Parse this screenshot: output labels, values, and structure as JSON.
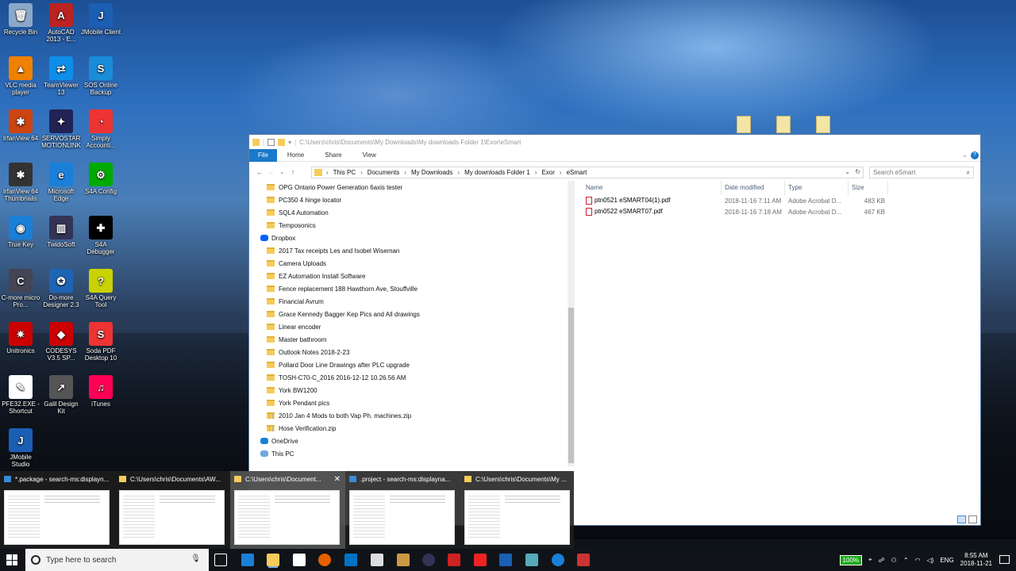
{
  "desktop_icons": [
    {
      "label": "Recycle Bin",
      "color": "#8ca8c8",
      "glyph": "🗑"
    },
    {
      "label": "AutoCAD 2013 - E...",
      "color": "#b22",
      "glyph": "A"
    },
    {
      "label": "JMobile Client",
      "color": "#1a5fb4",
      "glyph": "J"
    },
    {
      "label": "VLC media player",
      "color": "#f08000",
      "glyph": "▲"
    },
    {
      "label": "TeamViewer 13",
      "color": "#0e8ee9",
      "glyph": "⇄"
    },
    {
      "label": "SOS Online Backup",
      "color": "#1a8cd8",
      "glyph": "S"
    },
    {
      "label": "IrfanView 64",
      "color": "#c41",
      "glyph": "✱"
    },
    {
      "label": "SERVOSTAR MOTIONLINK",
      "color": "#225",
      "glyph": "✦"
    },
    {
      "label": "Simply Accounti...",
      "color": "#e33",
      "glyph": "◔"
    },
    {
      "label": "IrfanView 64 Thumbnails",
      "color": "#333",
      "glyph": "✱"
    },
    {
      "label": "Microsoft Edge",
      "color": "#1a7fd8",
      "glyph": "e"
    },
    {
      "label": "S4A Config",
      "color": "#0a0",
      "glyph": "⚙"
    },
    {
      "label": "True Key",
      "color": "#1a7fd8",
      "glyph": "◉"
    },
    {
      "label": "TwidoSoft",
      "color": "#335",
      "glyph": "▥"
    },
    {
      "label": "S4A Debugger",
      "color": "#000",
      "glyph": "✚"
    },
    {
      "label": "C-more micro Pro...",
      "color": "#445",
      "glyph": "C"
    },
    {
      "label": "Do-more Designer 2.3",
      "color": "#1e64b4",
      "glyph": "✪"
    },
    {
      "label": "S4A Query Tool",
      "color": "#c8d200",
      "glyph": "?"
    },
    {
      "label": "Unitronics",
      "color": "#c00",
      "glyph": "✷"
    },
    {
      "label": "CODESYS V3.5 SP...",
      "color": "#c00",
      "glyph": "◆"
    },
    {
      "label": "Soda PDF Desktop 10",
      "color": "#e33",
      "glyph": "S"
    },
    {
      "label": "PFE32.EXE - Shortcut",
      "color": "#fff",
      "glyph": "✎"
    },
    {
      "label": "Galil Design Kit",
      "color": "#555",
      "glyph": "↗"
    },
    {
      "label": "iTunes",
      "color": "#f05",
      "glyph": "♫"
    },
    {
      "label": "JMobile Studio",
      "color": "#1a5fb4",
      "glyph": "J"
    }
  ],
  "explorer": {
    "title_path": "C:\\Users\\chris\\Documents\\My Downloads\\My downloads Folder 1\\Exor\\eSmart",
    "ribbon_tabs": [
      "File",
      "Home",
      "Share",
      "View"
    ],
    "breadcrumb": [
      "This PC",
      "Documents",
      "My Downloads",
      "My downloads Folder 1",
      "Exor",
      "eSmart"
    ],
    "search_placeholder": "Search eSmart",
    "tree": [
      {
        "label": "OPG Ontario Power Generation 6axis tester",
        "kind": "folder"
      },
      {
        "label": "PC350 4 hinge locator",
        "kind": "folder"
      },
      {
        "label": "SQL4 Automation",
        "kind": "folder"
      },
      {
        "label": "Temposonics",
        "kind": "folder"
      },
      {
        "label": "Dropbox",
        "kind": "root"
      },
      {
        "label": "2017 Tax receipts Les and Isobel Wiseman",
        "kind": "folder"
      },
      {
        "label": "Camera Uploads",
        "kind": "folder"
      },
      {
        "label": "EZ Automation Install Software",
        "kind": "folder"
      },
      {
        "label": "Fence replacement 188 Hawthorn Ave, Stouffville",
        "kind": "folder"
      },
      {
        "label": "Financial Avrum",
        "kind": "folder"
      },
      {
        "label": "Grace Kennedy Bagger Kep Pics and All drawings",
        "kind": "folder"
      },
      {
        "label": "Linear encoder",
        "kind": "folder"
      },
      {
        "label": "Master bathroom",
        "kind": "folder"
      },
      {
        "label": "Outlook Notes 2018-2-23",
        "kind": "folder"
      },
      {
        "label": "Pollard Door Line Drawings after PLC upgrade",
        "kind": "folder"
      },
      {
        "label": "TOSH-C70-C_2016 2016-12-12 10.26.56 AM",
        "kind": "folder"
      },
      {
        "label": "York BW1200",
        "kind": "folder"
      },
      {
        "label": "York Pendant pics",
        "kind": "folder"
      },
      {
        "label": "2010 Jan 4  Mods to both Vap Ph. machines.zip",
        "kind": "zip"
      },
      {
        "label": "Hose Verification.zip",
        "kind": "zip"
      },
      {
        "label": "OneDrive",
        "kind": "root"
      },
      {
        "label": "This PC",
        "kind": "root"
      }
    ],
    "columns": [
      "Name",
      "Date modified",
      "Type",
      "Size"
    ],
    "files": [
      {
        "name": "ptn0521 eSMART04(1).pdf",
        "date": "2018-11-16 7:11 AM",
        "type": "Adobe Acrobat D...",
        "size": "483 KB"
      },
      {
        "name": "ptn0522 eSMART07.pdf",
        "date": "2018-11-16 7:18 AM",
        "type": "Adobe Acrobat D...",
        "size": "467 KB"
      }
    ]
  },
  "thumbnails": [
    {
      "label": "*.package - search-ms:displayn..."
    },
    {
      "label": "C:\\Users\\chris\\Documents\\AW..."
    },
    {
      "label": "C:\\Users\\chris\\Document..."
    },
    {
      "label": ".project - search-ms:displayna..."
    },
    {
      "label": "C:\\Users\\chris\\Documents\\My ..."
    }
  ],
  "taskbar": {
    "search_placeholder": "Type here to search",
    "battery": "100%",
    "lang": "ENG",
    "time": "8:55 AM",
    "date": "2018-11-21"
  }
}
